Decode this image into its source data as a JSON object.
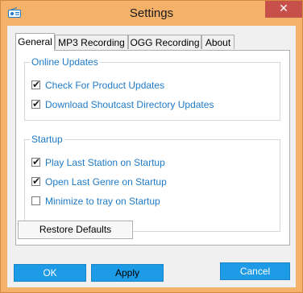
{
  "window": {
    "title": "Settings",
    "close_glyph": "✕",
    "accent_color": "#f3b169"
  },
  "tabs": [
    {
      "label": "General",
      "active": true
    },
    {
      "label": "MP3 Recording",
      "active": false
    },
    {
      "label": "OGG Recording",
      "active": false
    },
    {
      "label": "About",
      "active": false
    }
  ],
  "online_updates": {
    "title": "Online Updates",
    "options": [
      {
        "label": "Check For Product Updates",
        "checked": true
      },
      {
        "label": "Download Shoutcast Directory Updates",
        "checked": true
      }
    ]
  },
  "startup": {
    "title": "Startup",
    "options": [
      {
        "label": "Play Last Station on Startup",
        "checked": true
      },
      {
        "label": "Open Last Genre on Startup",
        "checked": true
      },
      {
        "label": "Minimize to tray on Startup",
        "checked": false
      }
    ]
  },
  "buttons": {
    "restore": "Restore Defaults",
    "ok": "OK",
    "apply": "Apply",
    "cancel": "Cancel"
  },
  "check_glyph": "✔"
}
